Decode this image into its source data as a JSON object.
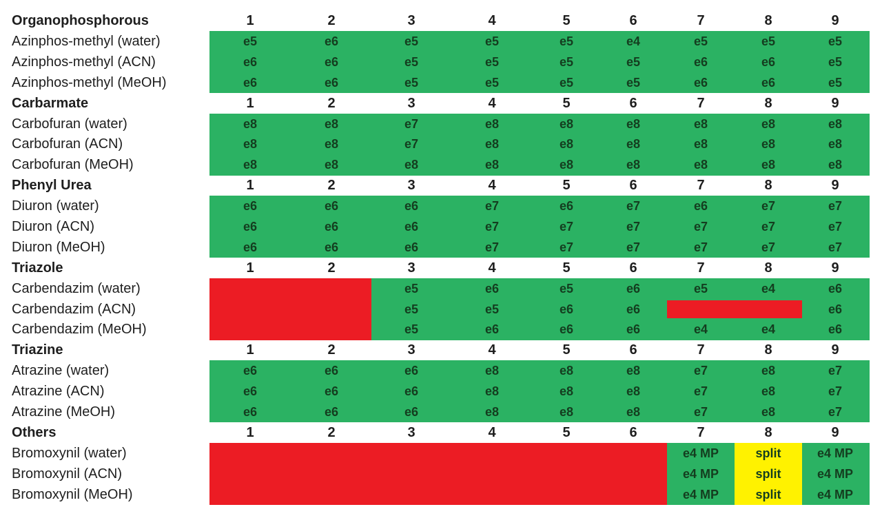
{
  "chart_data": {
    "type": "table",
    "title": "",
    "columns": [
      "1",
      "2",
      "3",
      "4",
      "5",
      "6",
      "7",
      "8",
      "9"
    ],
    "legend_colors": {
      "green": "#2bb263",
      "red": "#ec1c24",
      "yellow": "#fff200"
    },
    "groups": [
      {
        "name": "Organophosphorous",
        "rows": [
          {
            "label": "Azinphos-methyl (water)",
            "cells": [
              {
                "v": "e5",
                "c": "green"
              },
              {
                "v": "e6",
                "c": "green"
              },
              {
                "v": "e5",
                "c": "green"
              },
              {
                "v": "e5",
                "c": "green"
              },
              {
                "v": "e5",
                "c": "green"
              },
              {
                "v": "e4",
                "c": "green"
              },
              {
                "v": "e5",
                "c": "green"
              },
              {
                "v": "e5",
                "c": "green"
              },
              {
                "v": "e5",
                "c": "green"
              }
            ]
          },
          {
            "label": "Azinphos-methyl (ACN)",
            "cells": [
              {
                "v": "e6",
                "c": "green"
              },
              {
                "v": "e6",
                "c": "green"
              },
              {
                "v": "e5",
                "c": "green"
              },
              {
                "v": "e5",
                "c": "green"
              },
              {
                "v": "e5",
                "c": "green"
              },
              {
                "v": "e5",
                "c": "green"
              },
              {
                "v": "e6",
                "c": "green"
              },
              {
                "v": "e6",
                "c": "green"
              },
              {
                "v": "e5",
                "c": "green"
              }
            ]
          },
          {
            "label": "Azinphos-methyl (MeOH)",
            "cells": [
              {
                "v": "e6",
                "c": "green"
              },
              {
                "v": "e6",
                "c": "green"
              },
              {
                "v": "e5",
                "c": "green"
              },
              {
                "v": "e5",
                "c": "green"
              },
              {
                "v": "e5",
                "c": "green"
              },
              {
                "v": "e5",
                "c": "green"
              },
              {
                "v": "e6",
                "c": "green"
              },
              {
                "v": "e6",
                "c": "green"
              },
              {
                "v": "e5",
                "c": "green"
              }
            ]
          }
        ]
      },
      {
        "name": "Carbarmate",
        "rows": [
          {
            "label": "Carbofuran (water)",
            "cells": [
              {
                "v": "e8",
                "c": "green"
              },
              {
                "v": "e8",
                "c": "green"
              },
              {
                "v": "e7",
                "c": "green"
              },
              {
                "v": "e8",
                "c": "green"
              },
              {
                "v": "e8",
                "c": "green"
              },
              {
                "v": "e8",
                "c": "green"
              },
              {
                "v": "e8",
                "c": "green"
              },
              {
                "v": "e8",
                "c": "green"
              },
              {
                "v": "e8",
                "c": "green"
              }
            ]
          },
          {
            "label": "Carbofuran (ACN)",
            "cells": [
              {
                "v": "e8",
                "c": "green"
              },
              {
                "v": "e8",
                "c": "green"
              },
              {
                "v": "e7",
                "c": "green"
              },
              {
                "v": "e8",
                "c": "green"
              },
              {
                "v": "e8",
                "c": "green"
              },
              {
                "v": "e8",
                "c": "green"
              },
              {
                "v": "e8",
                "c": "green"
              },
              {
                "v": "e8",
                "c": "green"
              },
              {
                "v": "e8",
                "c": "green"
              }
            ]
          },
          {
            "label": "Carbofuran (MeOH)",
            "cells": [
              {
                "v": "e8",
                "c": "green"
              },
              {
                "v": "e8",
                "c": "green"
              },
              {
                "v": "e8",
                "c": "green"
              },
              {
                "v": "e8",
                "c": "green"
              },
              {
                "v": "e8",
                "c": "green"
              },
              {
                "v": "e8",
                "c": "green"
              },
              {
                "v": "e8",
                "c": "green"
              },
              {
                "v": "e8",
                "c": "green"
              },
              {
                "v": "e8",
                "c": "green"
              }
            ]
          }
        ]
      },
      {
        "name": "Phenyl Urea",
        "rows": [
          {
            "label": "Diuron (water)",
            "cells": [
              {
                "v": "e6",
                "c": "green"
              },
              {
                "v": "e6",
                "c": "green"
              },
              {
                "v": "e6",
                "c": "green"
              },
              {
                "v": "e7",
                "c": "green"
              },
              {
                "v": "e6",
                "c": "green"
              },
              {
                "v": "e7",
                "c": "green"
              },
              {
                "v": "e6",
                "c": "green"
              },
              {
                "v": "e7",
                "c": "green"
              },
              {
                "v": "e7",
                "c": "green"
              }
            ]
          },
          {
            "label": "Diuron (ACN)",
            "cells": [
              {
                "v": "e6",
                "c": "green"
              },
              {
                "v": "e6",
                "c": "green"
              },
              {
                "v": "e6",
                "c": "green"
              },
              {
                "v": "e7",
                "c": "green"
              },
              {
                "v": "e7",
                "c": "green"
              },
              {
                "v": "e7",
                "c": "green"
              },
              {
                "v": "e7",
                "c": "green"
              },
              {
                "v": "e7",
                "c": "green"
              },
              {
                "v": "e7",
                "c": "green"
              }
            ]
          },
          {
            "label": "Diuron (MeOH)",
            "cells": [
              {
                "v": "e6",
                "c": "green"
              },
              {
                "v": "e6",
                "c": "green"
              },
              {
                "v": "e6",
                "c": "green"
              },
              {
                "v": "e7",
                "c": "green"
              },
              {
                "v": "e7",
                "c": "green"
              },
              {
                "v": "e7",
                "c": "green"
              },
              {
                "v": "e7",
                "c": "green"
              },
              {
                "v": "e7",
                "c": "green"
              },
              {
                "v": "e7",
                "c": "green"
              }
            ]
          }
        ]
      },
      {
        "name": "Triazole",
        "rows": [
          {
            "label": "Carbendazim (water)",
            "cells": [
              {
                "v": "",
                "c": "red"
              },
              {
                "v": "",
                "c": "red"
              },
              {
                "v": "e5",
                "c": "green"
              },
              {
                "v": "e6",
                "c": "green"
              },
              {
                "v": "e5",
                "c": "green"
              },
              {
                "v": "e6",
                "c": "green"
              },
              {
                "v": "e5",
                "c": "green"
              },
              {
                "v": "e4",
                "c": "green"
              },
              {
                "v": "e6",
                "c": "green"
              }
            ]
          },
          {
            "label": "Carbendazim (ACN)",
            "cells": [
              {
                "v": "",
                "c": "red"
              },
              {
                "v": "",
                "c": "red"
              },
              {
                "v": "e5",
                "c": "green"
              },
              {
                "v": "e5",
                "c": "green"
              },
              {
                "v": "e6",
                "c": "green"
              },
              {
                "v": "e6",
                "c": "green"
              },
              {
                "v": "",
                "c": "red"
              },
              {
                "v": "",
                "c": "red"
              },
              {
                "v": "e6",
                "c": "green"
              }
            ]
          },
          {
            "label": "Carbendazim (MeOH)",
            "cells": [
              {
                "v": "",
                "c": "red"
              },
              {
                "v": "",
                "c": "red"
              },
              {
                "v": "e5",
                "c": "green"
              },
              {
                "v": "e6",
                "c": "green"
              },
              {
                "v": "e6",
                "c": "green"
              },
              {
                "v": "e6",
                "c": "green"
              },
              {
                "v": "e4",
                "c": "green"
              },
              {
                "v": "e4",
                "c": "green"
              },
              {
                "v": "e6",
                "c": "green"
              }
            ]
          }
        ]
      },
      {
        "name": "Triazine",
        "rows": [
          {
            "label": "Atrazine (water)",
            "cells": [
              {
                "v": "e6",
                "c": "green"
              },
              {
                "v": "e6",
                "c": "green"
              },
              {
                "v": "e6",
                "c": "green"
              },
              {
                "v": "e8",
                "c": "green"
              },
              {
                "v": "e8",
                "c": "green"
              },
              {
                "v": "e8",
                "c": "green"
              },
              {
                "v": "e7",
                "c": "green"
              },
              {
                "v": "e8",
                "c": "green"
              },
              {
                "v": "e7",
                "c": "green"
              }
            ]
          },
          {
            "label": "Atrazine (ACN)",
            "cells": [
              {
                "v": "e6",
                "c": "green"
              },
              {
                "v": "e6",
                "c": "green"
              },
              {
                "v": "e6",
                "c": "green"
              },
              {
                "v": "e8",
                "c": "green"
              },
              {
                "v": "e8",
                "c": "green"
              },
              {
                "v": "e8",
                "c": "green"
              },
              {
                "v": "e7",
                "c": "green"
              },
              {
                "v": "e8",
                "c": "green"
              },
              {
                "v": "e7",
                "c": "green"
              }
            ]
          },
          {
            "label": "Atrazine (MeOH)",
            "cells": [
              {
                "v": "e6",
                "c": "green"
              },
              {
                "v": "e6",
                "c": "green"
              },
              {
                "v": "e6",
                "c": "green"
              },
              {
                "v": "e8",
                "c": "green"
              },
              {
                "v": "e8",
                "c": "green"
              },
              {
                "v": "e8",
                "c": "green"
              },
              {
                "v": "e7",
                "c": "green"
              },
              {
                "v": "e8",
                "c": "green"
              },
              {
                "v": "e7",
                "c": "green"
              }
            ]
          }
        ]
      },
      {
        "name": "Others",
        "rows": [
          {
            "label": "Bromoxynil (water)",
            "cells": [
              {
                "v": "",
                "c": "red"
              },
              {
                "v": "",
                "c": "red"
              },
              {
                "v": "",
                "c": "red"
              },
              {
                "v": "",
                "c": "red"
              },
              {
                "v": "",
                "c": "red"
              },
              {
                "v": "",
                "c": "red"
              },
              {
                "v": "e4 MP",
                "c": "green"
              },
              {
                "v": "split",
                "c": "yellow"
              },
              {
                "v": "e4 MP",
                "c": "green"
              }
            ]
          },
          {
            "label": "Bromoxynil (ACN)",
            "cells": [
              {
                "v": "",
                "c": "red"
              },
              {
                "v": "",
                "c": "red"
              },
              {
                "v": "",
                "c": "red"
              },
              {
                "v": "",
                "c": "red"
              },
              {
                "v": "",
                "c": "red"
              },
              {
                "v": "",
                "c": "red"
              },
              {
                "v": "e4 MP",
                "c": "green"
              },
              {
                "v": "split",
                "c": "yellow"
              },
              {
                "v": "e4 MP",
                "c": "green"
              }
            ]
          },
          {
            "label": "Bromoxynil (MeOH)",
            "cells": [
              {
                "v": "",
                "c": "red"
              },
              {
                "v": "",
                "c": "red"
              },
              {
                "v": "",
                "c": "red"
              },
              {
                "v": "",
                "c": "red"
              },
              {
                "v": "",
                "c": "red"
              },
              {
                "v": "",
                "c": "red"
              },
              {
                "v": "e4 MP",
                "c": "green"
              },
              {
                "v": "split",
                "c": "yellow"
              },
              {
                "v": "e4 MP",
                "c": "green"
              }
            ]
          }
        ]
      }
    ]
  }
}
